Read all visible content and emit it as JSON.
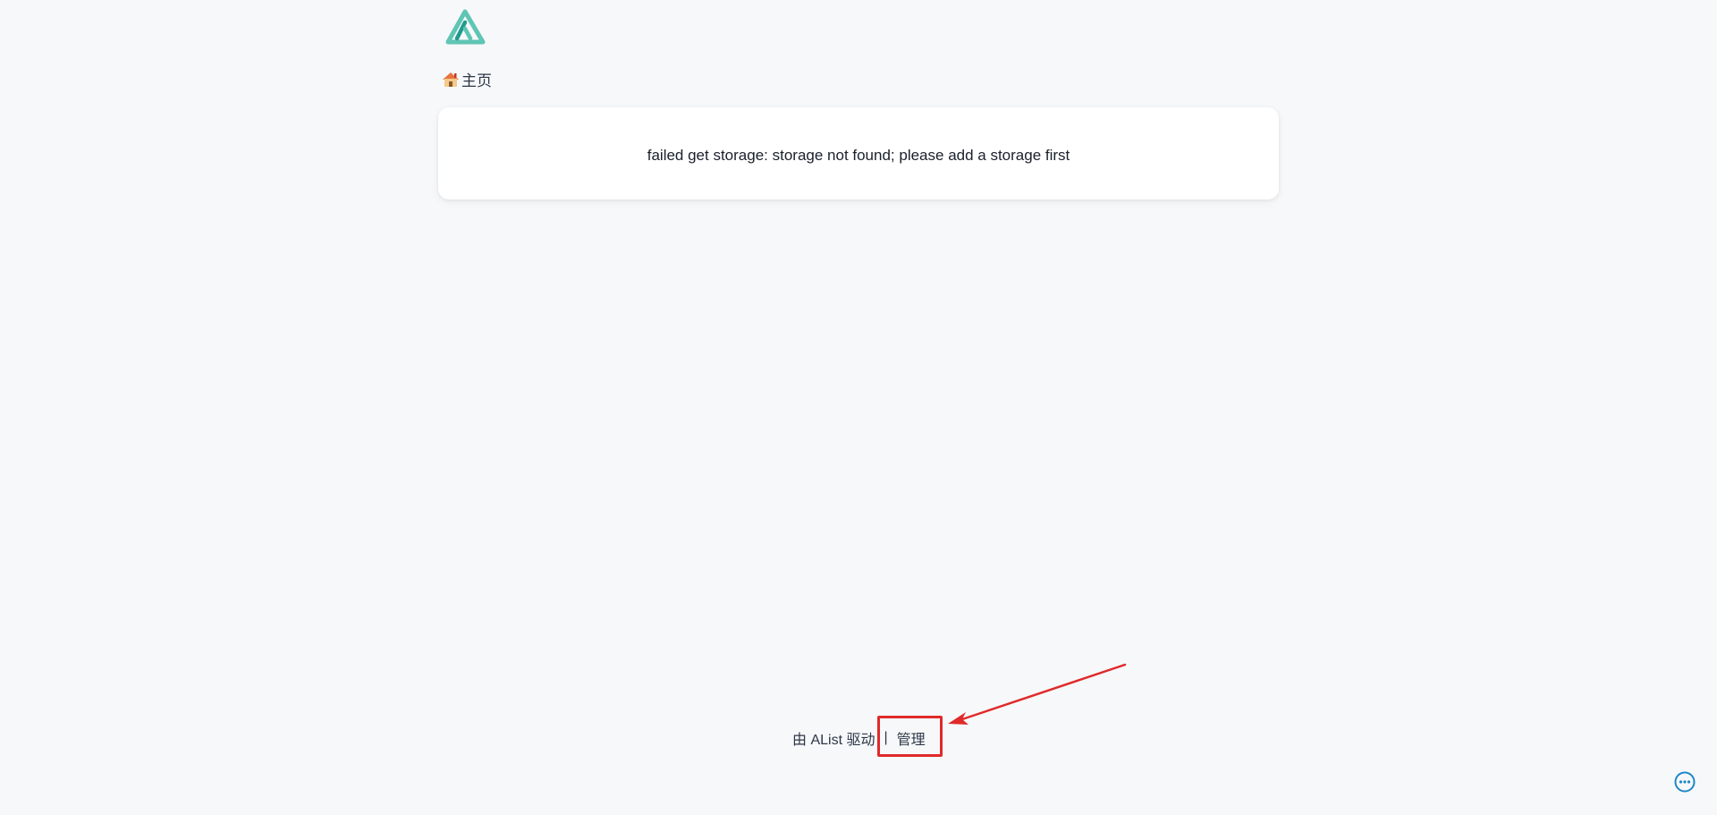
{
  "header": {
    "logo_icon": "alist-logo-icon",
    "logo_color": "#5fc5b4"
  },
  "breadcrumb": {
    "home_icon": "house-icon",
    "home_label": "主页"
  },
  "main": {
    "error_message": "failed get storage: storage not found; please add a storage first"
  },
  "footer": {
    "powered_by": "由 AList 驱动",
    "separator": "|",
    "manage_label": "管理"
  },
  "annotation": {
    "highlight_color": "#e02a2a"
  },
  "fab": {
    "icon": "more-horizontal-icon",
    "color": "#1e88c9"
  }
}
